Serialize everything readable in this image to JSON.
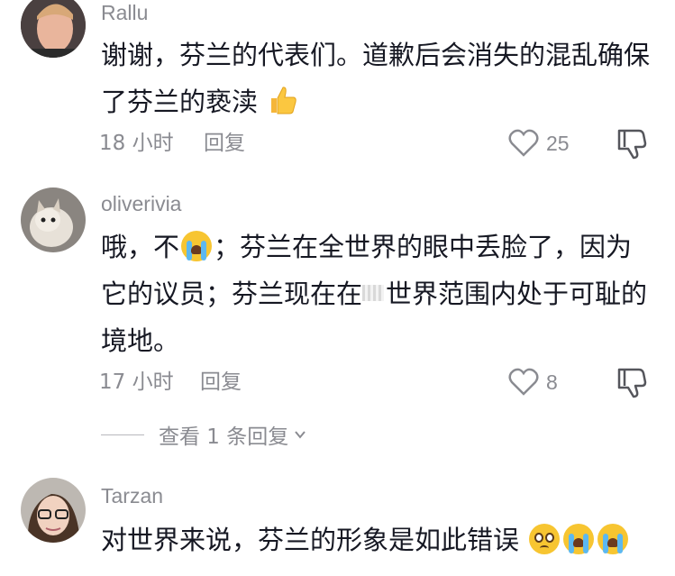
{
  "comments": [
    {
      "username": "Rallu",
      "text": "谢谢，芬兰的代表们。道歉后会消失的混乱确保了芬兰的亵渎",
      "emoji": "thumbs-up",
      "time": "18 小时",
      "reply_label": "回复",
      "likes": "25"
    },
    {
      "username": "oliverivia",
      "text_before_emoji": "哦，不",
      "emoji": "loudly-crying-face",
      "text_after_emoji": "；芬兰在全世界的眼中丢脸了，因为它的议员；芬兰现在在",
      "text_after_image": "世界范围内处于可耻的境地。",
      "time": "17 小时",
      "reply_label": "回复",
      "likes": "8"
    },
    {
      "username": "Tarzan",
      "text": "对世界来说，芬兰的形象是如此错误",
      "emojis": [
        "pleading-face",
        "loudly-crying-face",
        "loudly-crying-face"
      ]
    }
  ],
  "view_replies": "查看 1 条回复",
  "icons": {
    "like": "heart-outline-icon",
    "dislike": "thumbs-down-outline-icon",
    "expand": "chevron-down-icon"
  },
  "colors": {
    "text": "#161823",
    "secondary": "#8a8b91",
    "emoji_yellow": "#f7c531"
  }
}
